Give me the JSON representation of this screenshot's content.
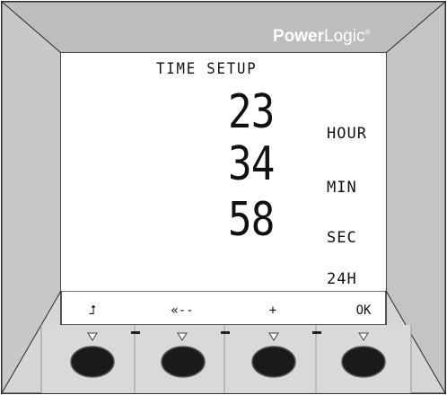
{
  "brand": {
    "name_bold": "Power",
    "name_regular": "Logic",
    "mark": "®"
  },
  "screen": {
    "title": "TIME SETUP",
    "hour_value": "23",
    "hour_unit": "HOUR",
    "minute_value": "34",
    "minute_unit": "MIN",
    "second_value": "58",
    "second_unit": "SEC",
    "mode": "24H"
  },
  "softkeys": [
    {
      "label": "⮥",
      "icon": "back-up-arrow-icon"
    },
    {
      "label": "«--",
      "icon": "left-arrow-icon"
    },
    {
      "label": "+",
      "icon": "plus-icon"
    },
    {
      "label": "OK",
      "icon": "ok-text"
    }
  ],
  "colors": {
    "bezel": "#d0d0d0",
    "bezel_edge": "#8e8e8e",
    "button": "#1a1a1a",
    "screen": "#ffffff"
  }
}
